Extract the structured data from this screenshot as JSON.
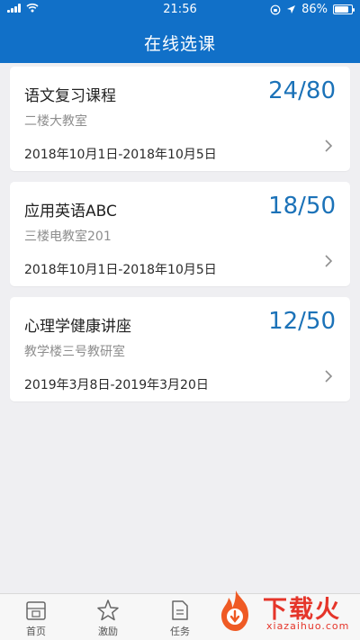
{
  "status": {
    "time": "21:56",
    "battery": "86%",
    "battery_level": 0.86
  },
  "header": {
    "title": "在线选课"
  },
  "courses": [
    {
      "name": "语文复习课程",
      "count": "24/80",
      "room": "二楼大教室",
      "date": "2018年10月1日-2018年10月5日"
    },
    {
      "name": "应用英语ABC",
      "count": "18/50",
      "room": "三楼电教室201",
      "date": "2018年10月1日-2018年10月5日"
    },
    {
      "name": "心理学健康讲座",
      "count": "12/50",
      "room": "教学楼三号教研室",
      "date": "2019年3月8日-2019年3月20日"
    }
  ],
  "tabs": [
    {
      "label": "首页",
      "icon": "home-icon"
    },
    {
      "label": "激励",
      "icon": "star-icon"
    },
    {
      "label": "任务",
      "icon": "task-icon"
    }
  ],
  "watermark": {
    "brand": "下载火",
    "domain": "xiazaihuo.com"
  },
  "colors": {
    "primary": "#1170c8",
    "count": "#1b72b8",
    "watermark": "#e5352a"
  }
}
